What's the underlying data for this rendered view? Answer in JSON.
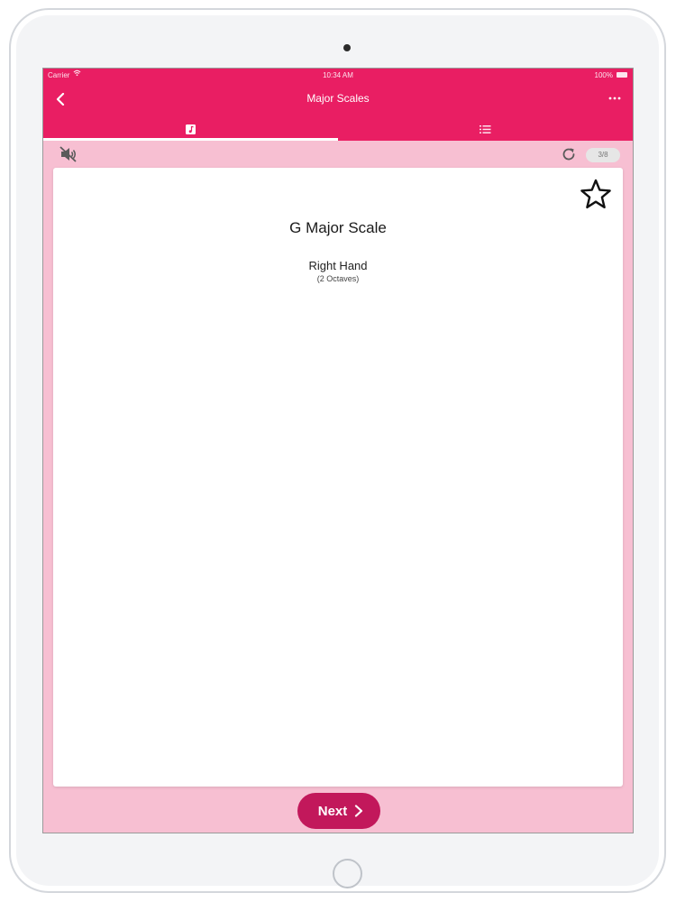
{
  "status_bar": {
    "carrier": "Carrier",
    "wifi_icon": "wifi-icon",
    "time": "10:34 AM",
    "battery_percent": "100%",
    "battery_icon": "battery-icon"
  },
  "nav": {
    "title": "Major Scales",
    "back_icon": "chevron-left-icon",
    "more_icon": "ellipsis-icon"
  },
  "tabs": [
    {
      "name": "flashcard",
      "icon": "music-note-icon",
      "active": true
    },
    {
      "name": "list",
      "icon": "list-icon",
      "active": false
    }
  ],
  "toolbar": {
    "mute_icon": "speaker-muted-icon",
    "refresh_icon": "refresh-icon",
    "progress": "3/8"
  },
  "card": {
    "title": "G Major Scale",
    "hand": "Right Hand",
    "octaves": "(2 Octaves)",
    "favorite_icon": "star-outline-icon"
  },
  "footer": {
    "next_label": "Next",
    "next_icon": "chevron-right-icon"
  },
  "colors": {
    "primary": "#e91e63",
    "background": "#f7bfd2",
    "button": "#c2185b"
  }
}
